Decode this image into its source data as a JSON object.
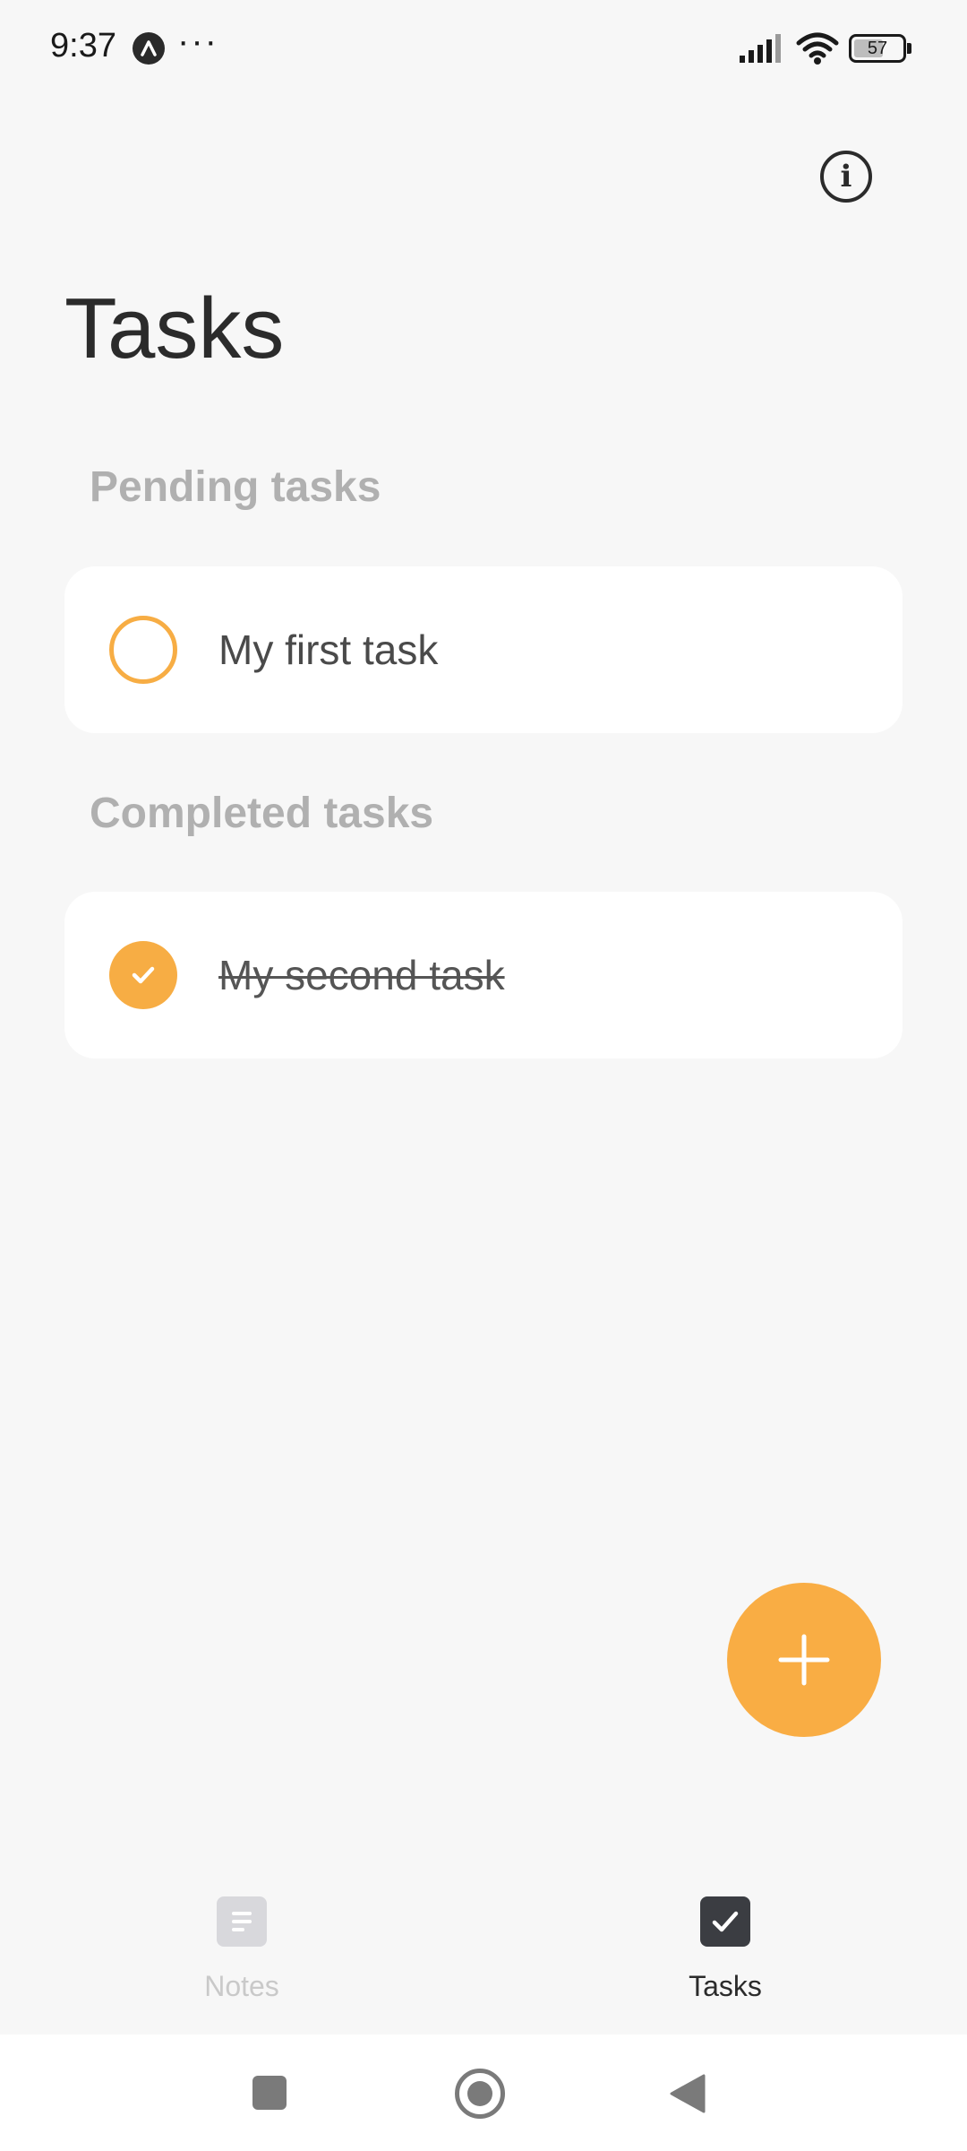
{
  "status_bar": {
    "time": "9:37",
    "dots": "···",
    "battery_level": "57",
    "icons": [
      "app-notification-icon",
      "signal-icon",
      "wifi-icon",
      "battery-icon"
    ]
  },
  "header": {
    "info_icon": "info-icon",
    "title": "Tasks"
  },
  "sections": {
    "pending_title": "Pending tasks",
    "completed_title": "Completed tasks"
  },
  "tasks": {
    "pending": [
      {
        "label": "My first task",
        "completed": false
      }
    ],
    "completed": [
      {
        "label": "My second task",
        "completed": true
      }
    ]
  },
  "fab": {
    "icon": "plus-icon"
  },
  "bottom_nav": {
    "items": [
      {
        "label": "Notes",
        "icon": "notes-icon",
        "active": false
      },
      {
        "label": "Tasks",
        "icon": "tasks-checkbox-icon",
        "active": true
      }
    ]
  },
  "colors": {
    "accent": "#f7ad44",
    "background": "#f7f7f7",
    "card": "#ffffff",
    "section_header": "#b0b0b0",
    "nav_inactive": "#c9c9c9",
    "nav_active": "#3b3d42"
  }
}
